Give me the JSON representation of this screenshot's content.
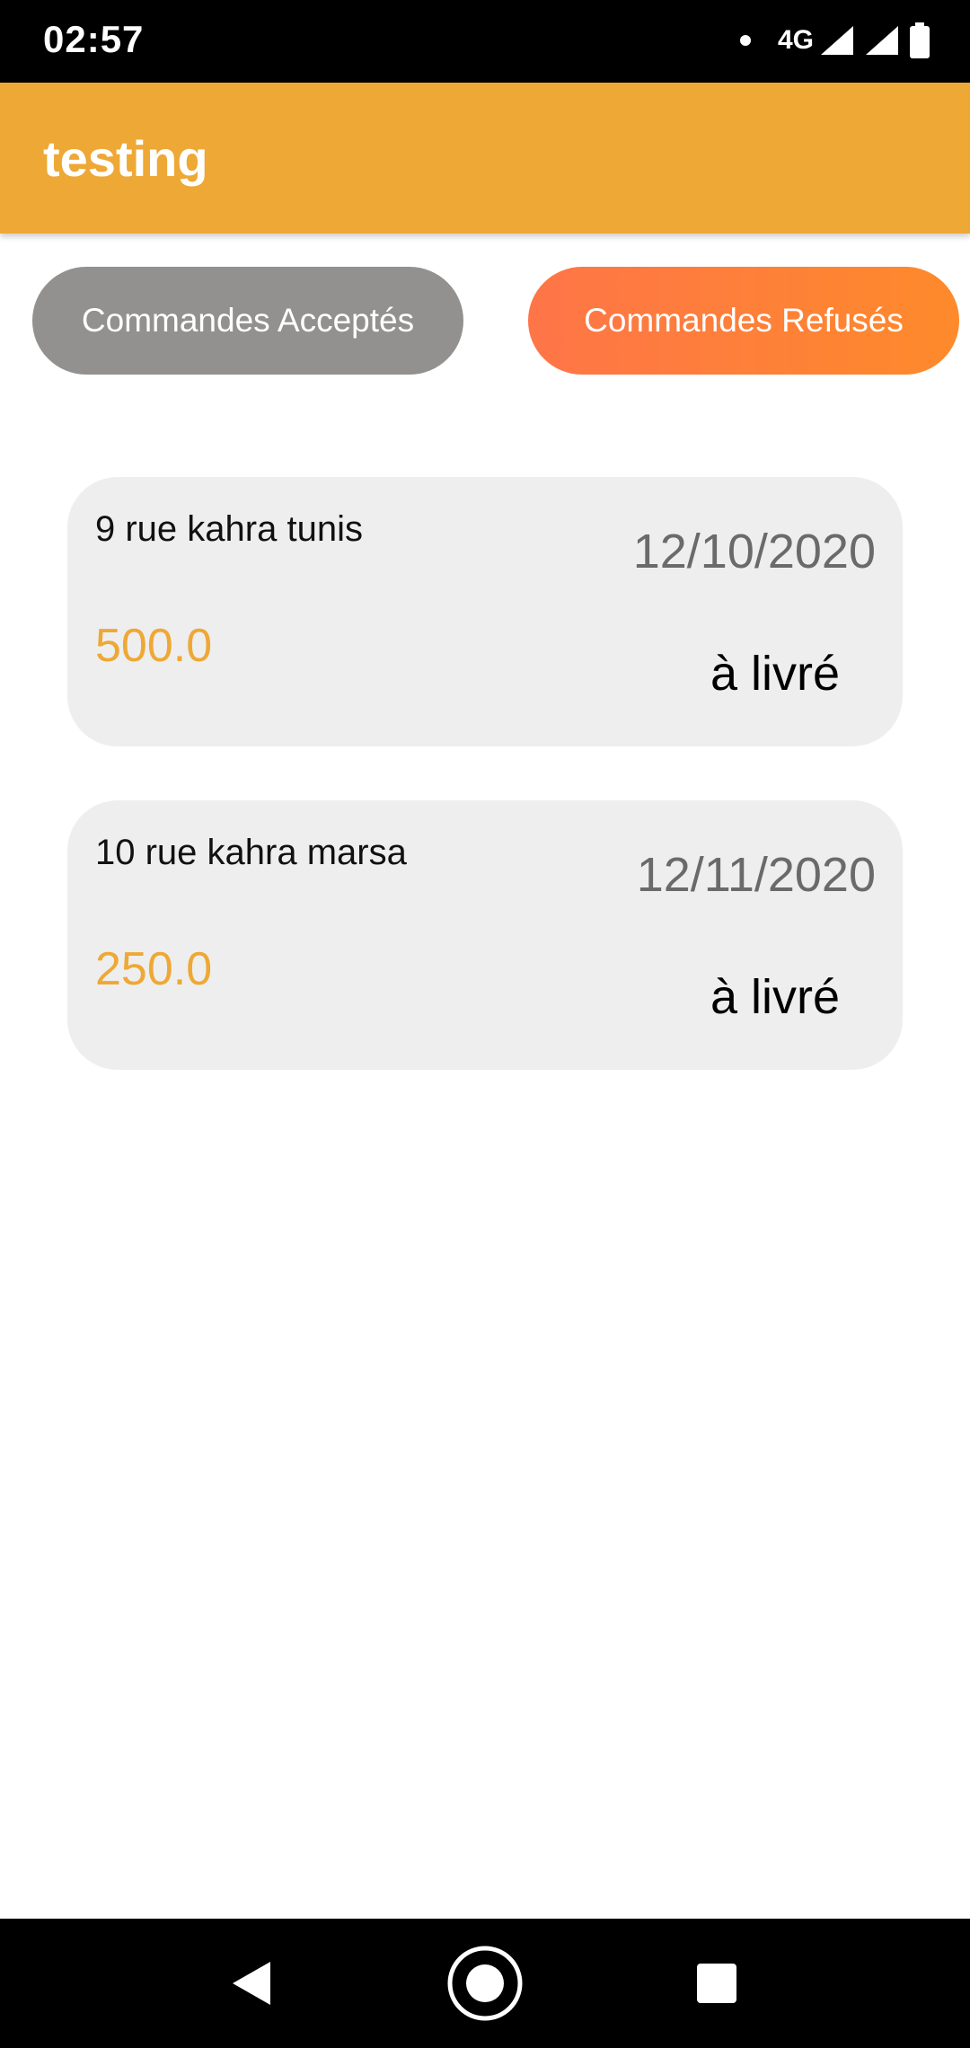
{
  "status_bar": {
    "time": "02:57",
    "network": "4G",
    "icons": [
      "notification-dot-icon",
      "signal-icon",
      "signal-icon",
      "battery-icon"
    ]
  },
  "app_bar": {
    "title": "testing",
    "background": "#EEA835"
  },
  "tabs": [
    {
      "label": "Commandes Acceptés",
      "color": "#929190"
    },
    {
      "label": "Commandes Refusés",
      "color": "#FE8035",
      "active": true
    }
  ],
  "orders": [
    {
      "address": "9 rue kahra tunis",
      "date": "12/10/2020",
      "price": "500.0",
      "status": "à livré"
    },
    {
      "address": "10 rue kahra marsa",
      "date": "12/11/2020",
      "price": "250.0",
      "status": "à livré"
    }
  ],
  "nav_bar": {
    "icons": [
      "back-icon",
      "home-icon",
      "recents-icon"
    ]
  },
  "colors": {
    "accent": "#EEA835",
    "card_bg": "#EEEEEE",
    "date_text": "#6A6A6A"
  }
}
